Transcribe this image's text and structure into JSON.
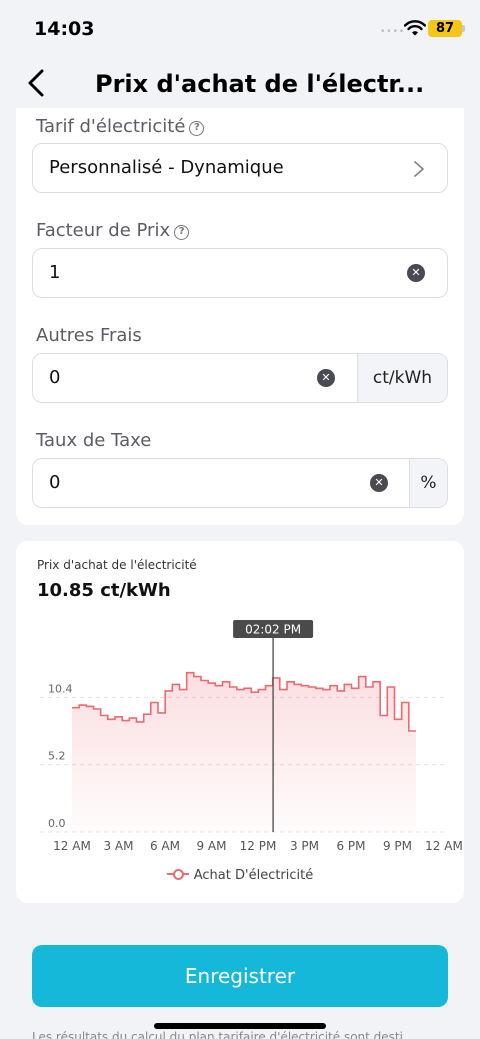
{
  "status_bar": {
    "time": "14:03",
    "battery": "87"
  },
  "nav": {
    "title": "Prix d'achat de l'électr..."
  },
  "form": {
    "tariff": {
      "label": "Tarif d'électricité",
      "value": "Personnalisé - Dynamique"
    },
    "price_factor": {
      "label": "Facteur de Prix",
      "value": "1"
    },
    "other_fees": {
      "label": "Autres Frais",
      "value": "0",
      "unit": "ct/kWh"
    },
    "tax_rate": {
      "label": "Taux de Taxe",
      "value": "0",
      "unit": "%"
    }
  },
  "chart": {
    "title": "Prix d'achat de l'électricité",
    "current_value": "10.85 ct/kWh",
    "cursor_label": "02:02 PM",
    "legend": "Achat D'électricité"
  },
  "save_label": "Enregistrer",
  "footer_note": "Les résultats du calcul du plan tarifaire d'électricité sont desti",
  "colors": {
    "accent": "#15b8d8",
    "series": "#ee6a72"
  },
  "chart_data": {
    "type": "area",
    "title": "Prix d'achat de l'électricité",
    "xlabel": "",
    "ylabel": "",
    "x_ticks": [
      "12 AM",
      "3 AM",
      "6 AM",
      "9 AM",
      "12 PM",
      "3 PM",
      "6 PM",
      "9 PM",
      "12 AM"
    ],
    "y_ticks": [
      "0.0",
      "5.2",
      "10.4"
    ],
    "ylim": [
      0,
      15.6
    ],
    "xlim": [
      0,
      24
    ],
    "grid": true,
    "legend_position": "bottom",
    "cursor_x": 14.03,
    "series": [
      {
        "name": "Achat D'électricité",
        "step": true,
        "x": [
          0,
          0.5,
          1,
          1.5,
          2,
          2.5,
          3,
          3.5,
          4,
          4.5,
          5,
          5.5,
          6,
          6.5,
          7,
          7.5,
          8,
          8.5,
          9,
          9.5,
          10,
          10.5,
          11,
          11.5,
          12,
          12.5,
          13,
          13.5,
          14,
          14.5,
          15,
          15.5,
          16,
          16.5,
          17,
          17.5,
          18,
          18.5,
          19,
          19.5,
          20,
          20.5,
          21,
          21.5,
          22,
          22.5,
          23,
          23.5
        ],
        "values": [
          9.6,
          9.8,
          9.7,
          9.5,
          9.0,
          8.7,
          8.9,
          8.6,
          8.8,
          8.5,
          9.1,
          10.0,
          9.2,
          10.9,
          11.4,
          11.0,
          12.3,
          12.0,
          11.7,
          11.5,
          11.3,
          11.6,
          11.2,
          11.0,
          11.1,
          10.8,
          11.0,
          11.3,
          11.9,
          11.0,
          11.6,
          11.4,
          11.3,
          11.2,
          11.1,
          11.0,
          11.3,
          10.9,
          11.4,
          11.1,
          12.0,
          11.2,
          11.6,
          9.0,
          11.2,
          8.7,
          10.0,
          7.8
        ]
      }
    ]
  }
}
